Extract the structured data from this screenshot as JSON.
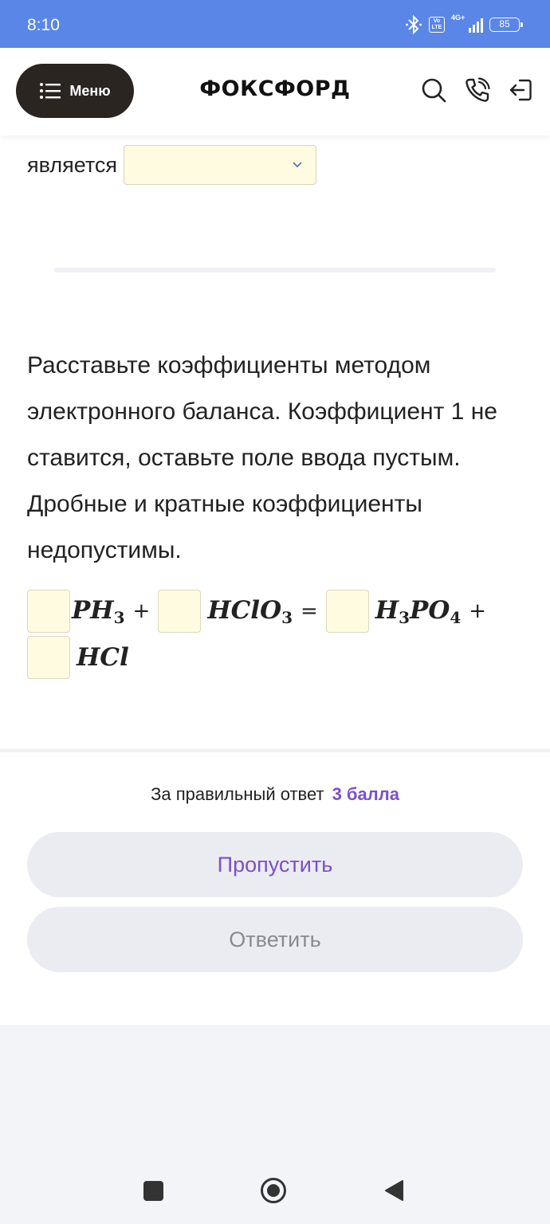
{
  "status_bar": {
    "time": "8:10",
    "volte_label": "Vo LTE",
    "network_label": "4G+",
    "battery_level": "85"
  },
  "header": {
    "menu_label": "Меню",
    "brand": "ФОКСФОРД",
    "icons": [
      "search-icon",
      "phone-icon",
      "logout-icon"
    ]
  },
  "previous_question": {
    "trailing_word": "является",
    "select_value": ""
  },
  "task": {
    "text": "Расставьте коэффициенты методом электронного баланса. Коэффициент 1 не ставится, оставьте поле ввода пустым. Дробные и кратные коэффициенты недопустимы.",
    "equation": {
      "term1": {
        "base": "PH",
        "sub": "3"
      },
      "term2": {
        "base": "HClO",
        "sub": "3"
      },
      "term3": {
        "pre": "H",
        "pre_sub": "3",
        "base": "PO",
        "sub": "4"
      },
      "term4": {
        "base": "HCl"
      },
      "plus": "+",
      "equals": "="
    }
  },
  "footer": {
    "score_label": "За правильный ответ",
    "score_value": "3 балла",
    "skip_label": "Пропустить",
    "answer_label": "Ответить"
  },
  "colors": {
    "status_bar": "#5a86e8",
    "accent": "#7a4fd0",
    "input_bg": "#fffbe0",
    "button_bg": "#ebecf1"
  }
}
